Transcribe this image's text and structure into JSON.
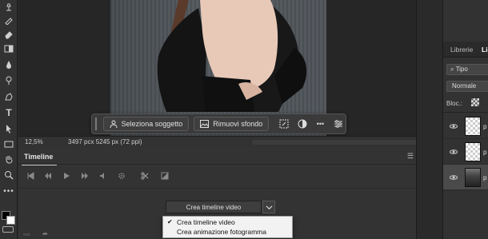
{
  "canvas": {
    "task_bar": {
      "select_subject": "Seleziona soggetto",
      "remove_background": "Rimuovi sfondo"
    }
  },
  "status_bar": {
    "zoom": "12,5%",
    "doc_info": "3497 pcx 5245 px (72 ppi)"
  },
  "timeline": {
    "title": "Timeline",
    "create_button": "Crea timeline video",
    "dropdown": {
      "options": [
        "Crea timeline video",
        "Crea animazione fotogramma"
      ],
      "checked_index": 0
    }
  },
  "layers_panel": {
    "tabs": [
      "Librerie",
      "Li"
    ],
    "filter_label": "Tipo",
    "blend_mode": "Normale",
    "lock_label": "Bloc.:",
    "layer_names": [
      "p",
      "p",
      "p"
    ]
  }
}
